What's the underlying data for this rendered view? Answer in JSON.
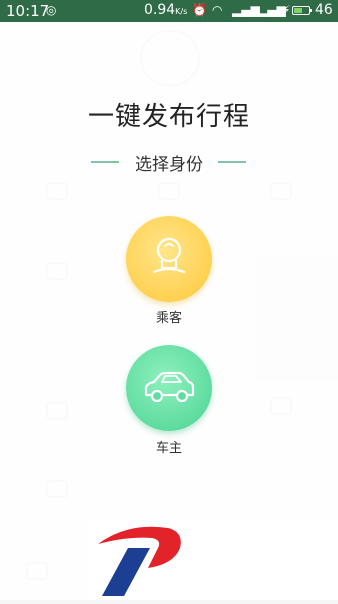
{
  "status_bar": {
    "time": "10:17",
    "speed_value": "0.94",
    "speed_unit": "K/s",
    "battery_percent": "46"
  },
  "dialog": {
    "title": "一键发布行程",
    "subtitle": "选择身份",
    "roles": [
      {
        "label": "乘客",
        "icon": "passenger-icon",
        "color": "#ffd152"
      },
      {
        "label": "车主",
        "icon": "car-icon",
        "color": "#5fdca0"
      }
    ]
  },
  "colors": {
    "status_bar_bg": "#2f6b46",
    "accent_line": "#7fc6a4"
  }
}
